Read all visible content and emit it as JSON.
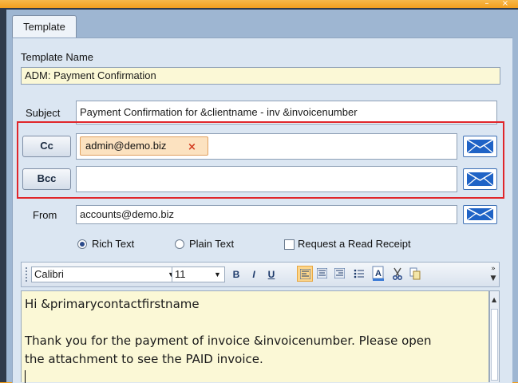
{
  "window": {
    "minimize_glyph": "–",
    "close_glyph": "×"
  },
  "tabs": [
    {
      "label": "Template"
    }
  ],
  "template_name": {
    "label": "Template Name",
    "value": "ADM:  Payment Confirmation"
  },
  "subject": {
    "label": "Subject",
    "value": "Payment Confirmation for &clientname - inv &invoicenumber"
  },
  "cc": {
    "button_label": "Cc",
    "chips": [
      {
        "email": "admin@demo.biz",
        "remove_glyph": "×"
      }
    ]
  },
  "bcc": {
    "button_label": "Bcc",
    "value": ""
  },
  "from": {
    "label": "From",
    "value": "accounts@demo.biz"
  },
  "format": {
    "rich_text": "Rich Text",
    "plain_text": "Plain Text",
    "selected": "rich_text"
  },
  "read_receipt": {
    "label": "Request a Read Receipt",
    "checked": false
  },
  "toolbar": {
    "font": "Calibri",
    "size": "11",
    "bold": "B",
    "italic": "I",
    "underline": "U",
    "overflow_glyph": "»"
  },
  "editor": {
    "lines": [
      "Hi &primarycontactfirstname",
      "",
      "Thank you for the payment of invoice &invoicenumber. Please open",
      "the attachment to see the PAID invoice."
    ]
  },
  "colors": {
    "accent_orange": "#f59c12",
    "field_yellow": "#fbf8d6",
    "highlight_red": "#e0262b",
    "mail_blue": "#1f63c6"
  }
}
